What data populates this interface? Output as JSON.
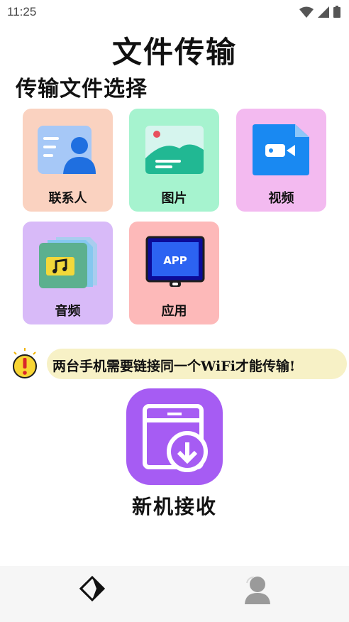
{
  "status_bar": {
    "time": "11:25"
  },
  "header": {
    "title": "文件传输"
  },
  "section": {
    "title": "传输文件选择"
  },
  "categories": [
    {
      "label": "联系人",
      "color": "#fad2c0"
    },
    {
      "label": "图片",
      "color": "#a6f3cf"
    },
    {
      "label": "视频",
      "color": "#f3baf0"
    },
    {
      "label": "音频",
      "color": "#d8baf8"
    },
    {
      "label": "应用",
      "color": "#fdb9b9"
    }
  ],
  "notice": {
    "text": "两台手机需要链接同一个WiFi才能传输!"
  },
  "receive": {
    "label": "新机接收",
    "color": "#a65cf3"
  },
  "app_icon_text": "APP"
}
